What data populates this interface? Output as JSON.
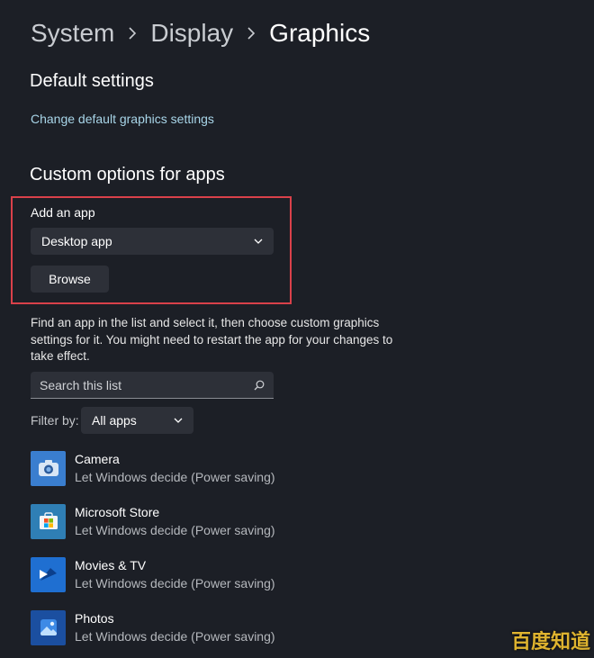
{
  "breadcrumb": {
    "items": [
      "System",
      "Display",
      "Graphics"
    ]
  },
  "default_settings": {
    "title": "Default settings",
    "link": "Change default graphics settings"
  },
  "custom_options": {
    "title": "Custom options for apps",
    "add_app_label": "Add an app",
    "app_type_selected": "Desktop app",
    "browse_label": "Browse",
    "description": "Find an app in the list and select it, then choose custom graphics settings for it. You might need to restart the app for your changes to take effect.",
    "search_placeholder": "Search this list",
    "filter_label": "Filter by:",
    "filter_selected": "All apps"
  },
  "apps": [
    {
      "name": "Camera",
      "status": "Let Windows decide (Power saving)",
      "icon": "camera-icon"
    },
    {
      "name": "Microsoft Store",
      "status": "Let Windows decide (Power saving)",
      "icon": "store-icon"
    },
    {
      "name": "Movies & TV",
      "status": "Let Windows decide (Power saving)",
      "icon": "movies-icon"
    },
    {
      "name": "Photos",
      "status": "Let Windows decide (Power saving)",
      "icon": "photos-icon"
    }
  ],
  "watermark": "百度知道",
  "colors": {
    "background": "#1c1f26",
    "link": "#a8d5e8",
    "highlight_border": "#d9414a",
    "control": "#2d3038"
  }
}
